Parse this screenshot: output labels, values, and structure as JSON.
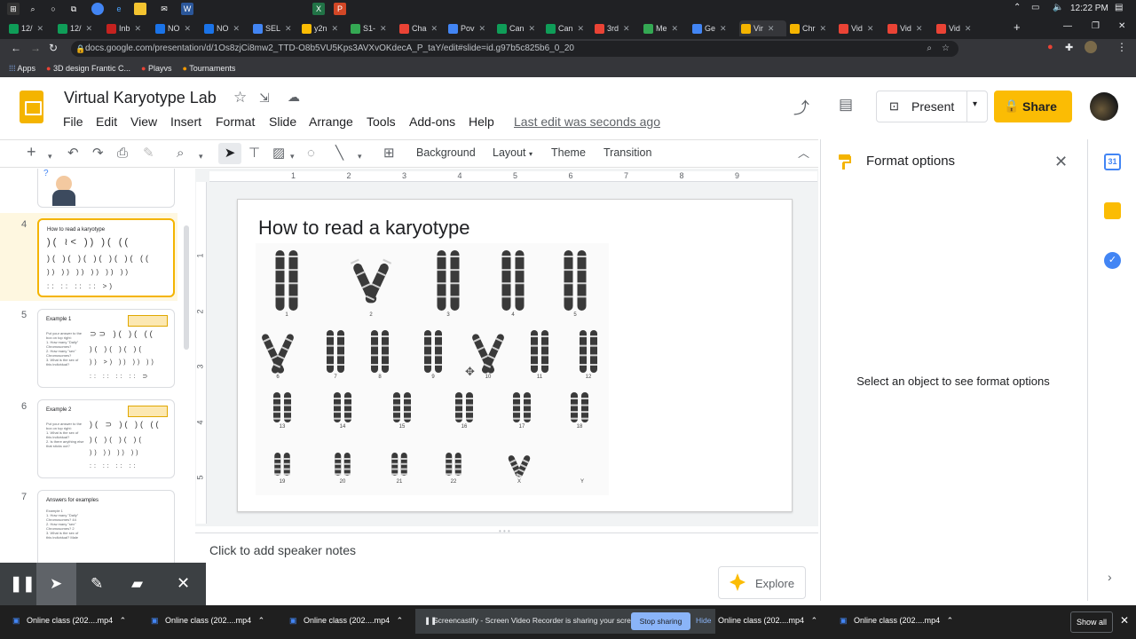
{
  "system": {
    "time": "12:22 PM"
  },
  "browser": {
    "tabs": [
      "12/",
      "12/",
      "Inb",
      "NO",
      "NO",
      "SEL",
      "y2n",
      "S1-",
      "Cha",
      "Pov",
      "Can",
      "Can",
      "3rd",
      "Me",
      "Ge",
      "Vir",
      "Chr",
      "Vid",
      "Vid",
      "Vid"
    ],
    "url": "docs.google.com/presentation/d/1Os8zjCi8mw2_TTD-O8b5VU5Kps3AVXvOKdecA_P_taY/edit#slide=id.g97b5c825b6_0_20",
    "bookmarks": [
      "Apps",
      "3D design Frantic C...",
      "Playvs",
      "Tournaments"
    ]
  },
  "doc": {
    "title": "Virtual Karyotype Lab",
    "menu": [
      "File",
      "Edit",
      "View",
      "Insert",
      "Format",
      "Slide",
      "Arrange",
      "Tools",
      "Add-ons",
      "Help"
    ],
    "last_edit": "Last edit was seconds ago",
    "present_label": "Present",
    "share_label": "Share"
  },
  "toolbar": {
    "background": "Background",
    "layout": "Layout",
    "theme": "Theme",
    "transition": "Transition"
  },
  "filmstrip": {
    "slides": [
      {
        "num": "4",
        "title": "How to read a karyotype"
      },
      {
        "num": "5",
        "title": "Example 1",
        "lines": [
          "Put your answer to the",
          "box on top right:",
          "1. How many \"Daily\"",
          "Chromosomes?",
          "2. How many \"sex\"",
          "Chromosomes?",
          "3. What is the sex of",
          "this individual?"
        ]
      },
      {
        "num": "6",
        "title": "Example 2",
        "lines": [
          "Put your answer to the",
          "box on top right:",
          "1. What is the sex of",
          "this individual?",
          "2. Is there anything else",
          "that sticks out?"
        ]
      },
      {
        "num": "7",
        "title": "Answers for examples",
        "lines": [
          "Example 1",
          "1. How many \"Daily\"",
          "Chromosomes? 44",
          "2. How many \"sex\"",
          "Chromosomes? 2",
          "3. What is the sex of",
          "this individual? Male"
        ]
      }
    ]
  },
  "slide": {
    "title": "How to read a karyotype",
    "ruler_numbers": [
      "1",
      "2",
      "3",
      "4",
      "5",
      "6",
      "7",
      "8",
      "9"
    ],
    "vruler_numbers": [
      "1",
      "2",
      "3",
      "4",
      "5"
    ],
    "karyotype_labels": [
      "1",
      "2",
      "3",
      "4",
      "5",
      "6",
      "7",
      "8",
      "9",
      "10",
      "11",
      "12",
      "13",
      "14",
      "15",
      "16",
      "17",
      "18",
      "19",
      "20",
      "21",
      "22",
      "X",
      "Y"
    ]
  },
  "notes": {
    "placeholder": "Click to add speaker notes"
  },
  "explore": {
    "label": "Explore"
  },
  "format_panel": {
    "title": "Format options",
    "message": "Select an object to see format options"
  },
  "taskbar": {
    "items": [
      "Online class (202....mp4",
      "Online class (202....mp4",
      "Online class (202....mp4",
      "Online class (202....mp4",
      "Online class (202....mp4"
    ],
    "notice": "Screencastify - Screen Video Recorder is sharing your screen.",
    "stop_sharing": "Stop sharing",
    "hide": "Hide",
    "show_all": "Show all"
  },
  "colors": {
    "share": "#fbbc04",
    "logo": "#f4b400",
    "selected_thumb": "#fef7e0"
  }
}
